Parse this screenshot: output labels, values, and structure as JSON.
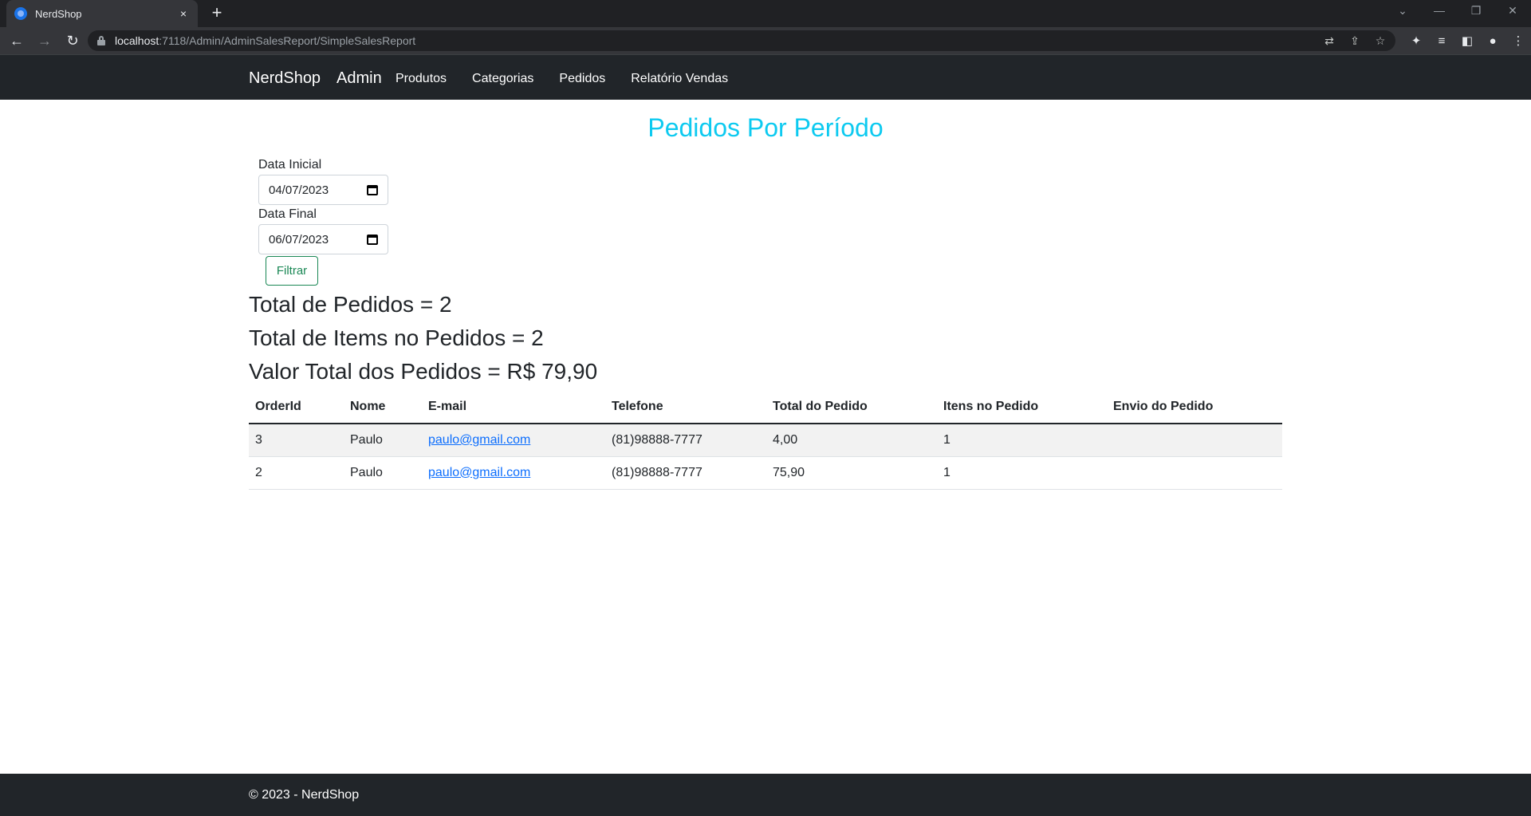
{
  "browser": {
    "tab_title": "NerdShop",
    "tab_close": "×",
    "new_tab": "+",
    "url_host": "localhost",
    "url_path": ":7118/Admin/AdminSalesReport/SimpleSalesReport"
  },
  "navbar": {
    "brand": "NerdShop",
    "admin": "Admin",
    "links": [
      "Produtos",
      "Categorias",
      "Pedidos",
      "Relatório Vendas"
    ]
  },
  "page": {
    "title": "Pedidos Por Período"
  },
  "filter": {
    "start_label": "Data Inicial",
    "start_value": "04/07/2023",
    "end_label": "Data Final",
    "end_value": "06/07/2023",
    "button_label": "Filtrar"
  },
  "summary": {
    "total_orders": "Total de Pedidos = 2",
    "total_items": "Total de Items no Pedidos = 2",
    "total_value": "Valor Total dos Pedidos = R$ 79,90"
  },
  "table": {
    "headers": [
      "OrderId",
      "Nome",
      "E-mail",
      "Telefone",
      "Total do Pedido",
      "Itens no Pedido",
      "Envio do Pedido"
    ],
    "rows": [
      [
        "3",
        "Paulo",
        "paulo@gmail.com",
        "(81)98888-7777",
        "4,00",
        "1",
        ""
      ],
      [
        "2",
        "Paulo",
        "paulo@gmail.com",
        "(81)98888-7777",
        "75,90",
        "1",
        ""
      ]
    ]
  },
  "footer": {
    "text": "© 2023 - NerdShop"
  },
  "colors": {
    "navbar_bg": "#212529",
    "title": "#0dcaf0",
    "filter_button": "#198754",
    "link": "#0d6efd"
  }
}
